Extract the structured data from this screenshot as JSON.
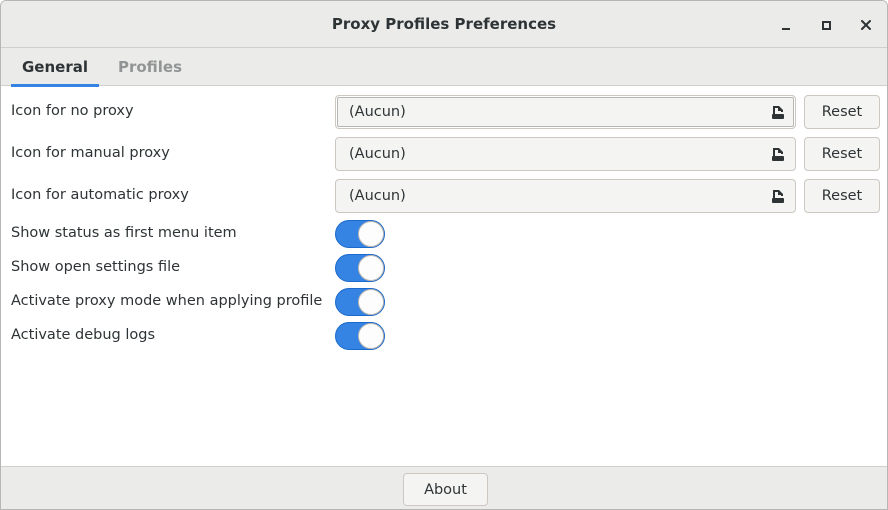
{
  "window": {
    "title": "Proxy Profiles Preferences"
  },
  "tabs": [
    {
      "label": "General",
      "active": true
    },
    {
      "label": "Profiles",
      "active": false
    }
  ],
  "file_rows": [
    {
      "label": "Icon for no proxy",
      "value": "(Aucun)",
      "reset_label": "Reset"
    },
    {
      "label": "Icon for manual proxy",
      "value": "(Aucun)",
      "reset_label": "Reset"
    },
    {
      "label": "Icon for automatic proxy",
      "value": "(Aucun)",
      "reset_label": "Reset"
    }
  ],
  "switch_rows": [
    {
      "label": "Show status as first menu item",
      "on": true
    },
    {
      "label": "Show open settings file",
      "on": true
    },
    {
      "label": "Activate proxy mode when applying profile",
      "on": true
    },
    {
      "label": "Activate debug logs",
      "on": true
    }
  ],
  "footer": {
    "about_label": "About"
  },
  "colors": {
    "accent": "#3584e4",
    "headerbar": "#ebebea",
    "text": "#2e3436",
    "inactive_tab": "#929595"
  },
  "icons": {
    "file_chooser": "document-open-icon",
    "minimize": "minimize-icon",
    "maximize": "maximize-icon",
    "close": "close-icon"
  }
}
